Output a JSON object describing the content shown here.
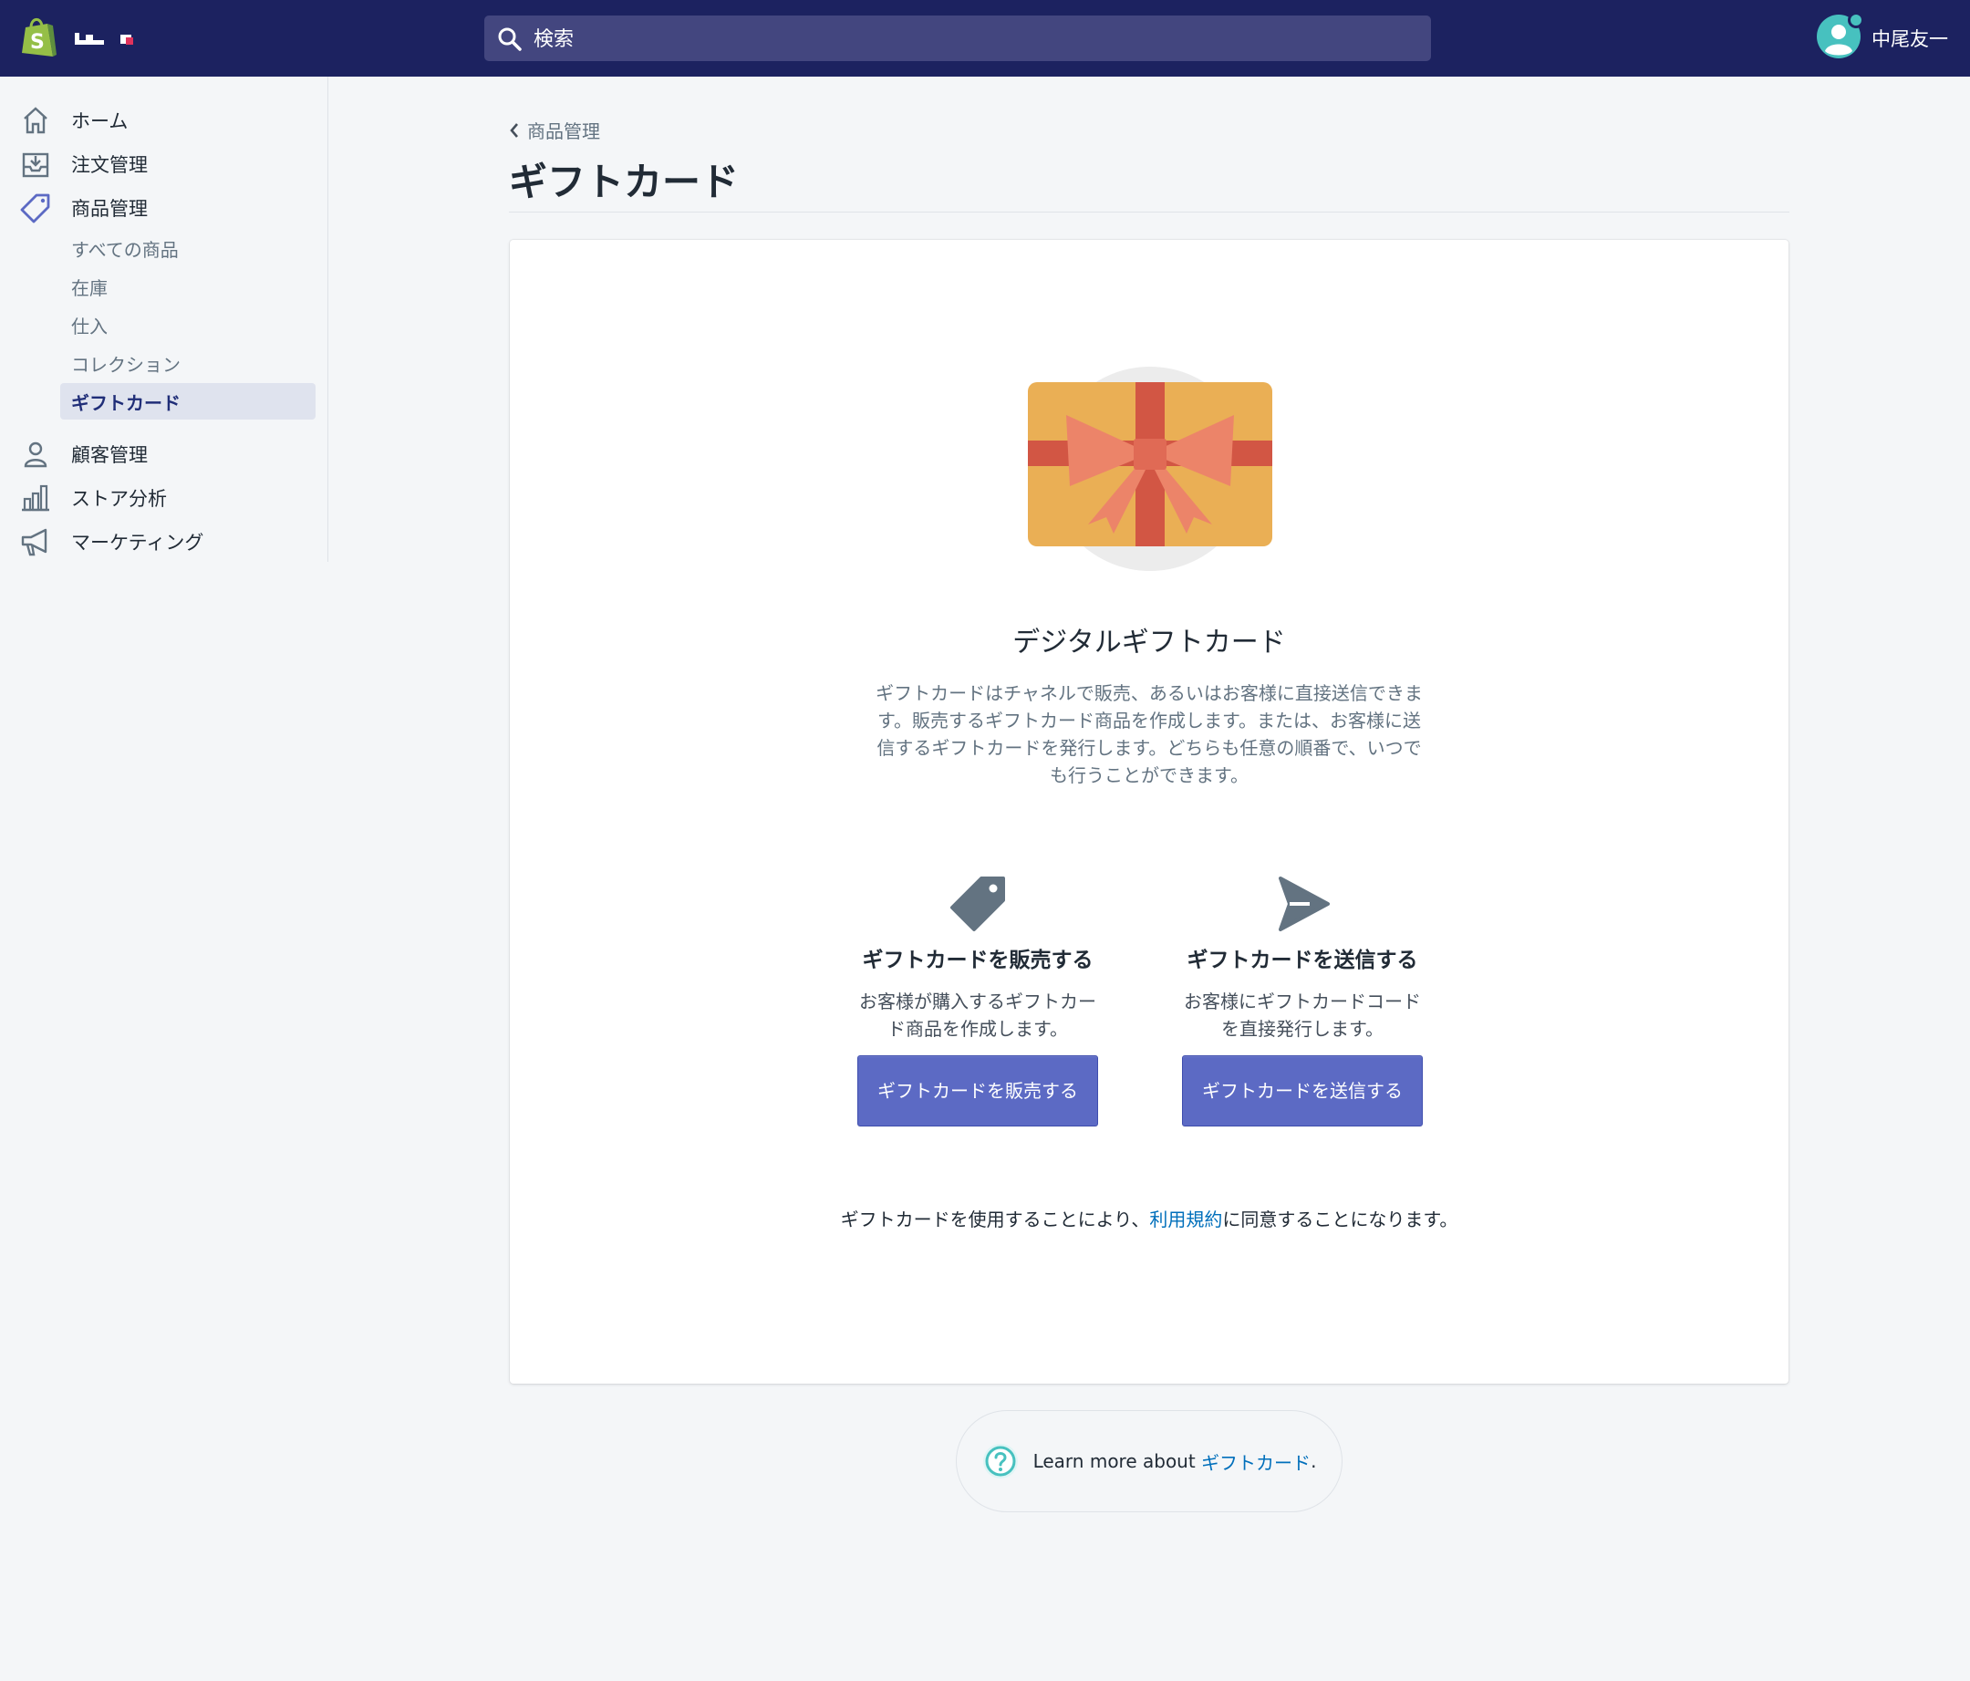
{
  "topbar": {
    "search_placeholder": "検索",
    "user_name": "中尾友一"
  },
  "sidebar": {
    "items": [
      {
        "label": "ホーム",
        "icon": "home-icon"
      },
      {
        "label": "注文管理",
        "icon": "orders-icon"
      },
      {
        "label": "商品管理",
        "icon": "tag-icon"
      },
      {
        "label": "顧客管理",
        "icon": "person-icon"
      },
      {
        "label": "ストア分析",
        "icon": "analytics-icon"
      },
      {
        "label": "マーケティング",
        "icon": "megaphone-icon"
      }
    ],
    "sub_items": [
      {
        "label": "すべての商品"
      },
      {
        "label": "在庫"
      },
      {
        "label": "仕入"
      },
      {
        "label": "コレクション"
      },
      {
        "label": "ギフトカード",
        "active": true
      }
    ]
  },
  "main": {
    "breadcrumb": "商品管理",
    "title": "ギフトカード",
    "card": {
      "heading": "デジタルギフトカード",
      "description": "ギフトカードはチャネルで販売、あるいはお客様に直接送信できます。販売するギフトカード商品を作成します。または、お客様に送信するギフトカードを発行します。どちらも任意の順番で、いつでも行うことができます。",
      "options": [
        {
          "icon": "price-tag-icon",
          "title": "ギフトカードを販売する",
          "text": "お客様が購入するギフトカード商品を作成します。",
          "button": "ギフトカードを販売する"
        },
        {
          "icon": "send-icon",
          "title": "ギフトカードを送信する",
          "text": "お客様にギフトカードコードを直接発行します。",
          "button": "ギフトカードを送信する"
        }
      ],
      "tos_before": "ギフトカードを使用することにより、",
      "tos_link": "利用規約",
      "tos_after": "に同意することになります。"
    },
    "help": {
      "prefix": "Learn more about ",
      "link": "ギフトカード",
      "suffix": "."
    }
  },
  "colors": {
    "topbar": "#1c2260",
    "primary_button": "#5c6ac4",
    "link": "#006fbb",
    "gift_card": "#eaaf55",
    "ribbon": "#d25644"
  }
}
